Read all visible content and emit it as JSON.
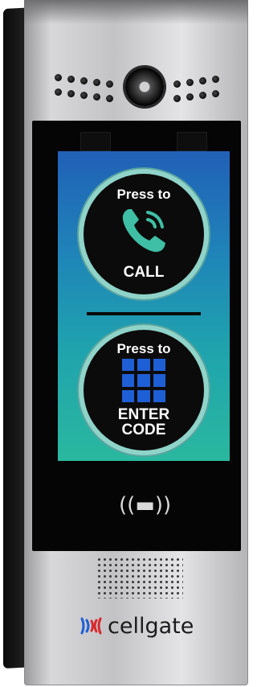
{
  "device": {
    "call_button": {
      "top_text": "Press to",
      "bottom_text": "CALL",
      "icon": "phone-icon"
    },
    "code_button": {
      "top_text": "Press to",
      "bottom_line1": "ENTER",
      "bottom_line2": "CODE",
      "icon": "keypad-icon"
    },
    "nfc_symbol": "((▬))",
    "brand": "cellgate"
  },
  "colors": {
    "screen_top": "#2160b7",
    "screen_bottom": "#2ab89f",
    "phone_icon": "#3fbfa5",
    "keypad": "#1f5fd6",
    "button_ring": "#8fd3c9"
  }
}
